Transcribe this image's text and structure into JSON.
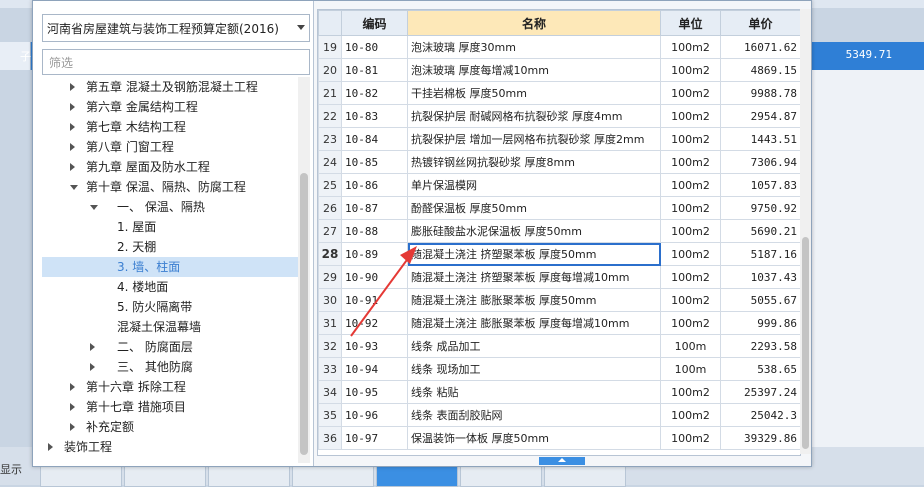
{
  "background": {
    "row_value": "5349.71",
    "row_left_char": "子",
    "bottom_label": "显示"
  },
  "dialog": {
    "library": "河南省房屋建筑与装饰工程预算定额(2016)",
    "filter_placeholder": "筛选",
    "tree": [
      {
        "label": "第五章 混凝土及钢筋混凝土工程",
        "level": 1,
        "toggle": "collapsed",
        "selected": false
      },
      {
        "label": "第六章 金属结构工程",
        "level": 1,
        "toggle": "collapsed",
        "selected": false
      },
      {
        "label": "第七章 木结构工程",
        "level": 1,
        "toggle": "collapsed",
        "selected": false
      },
      {
        "label": "第八章 门窗工程",
        "level": 1,
        "toggle": "collapsed",
        "selected": false
      },
      {
        "label": "第九章 屋面及防水工程",
        "level": 1,
        "toggle": "collapsed",
        "selected": false
      },
      {
        "label": "第十章 保温、隔热、防腐工程",
        "level": 1,
        "toggle": "expanded",
        "selected": false
      },
      {
        "label": "一、 保温、隔热",
        "level": 2,
        "toggle": "expanded",
        "selected": false
      },
      {
        "label": "1. 屋面",
        "level": 3,
        "toggle": "none",
        "selected": false
      },
      {
        "label": "2. 天棚",
        "level": 3,
        "toggle": "none",
        "selected": false
      },
      {
        "label": "3. 墙、柱面",
        "level": 3,
        "toggle": "none",
        "selected": true
      },
      {
        "label": "4. 楼地面",
        "level": 3,
        "toggle": "none",
        "selected": false
      },
      {
        "label": "5. 防火隔离带",
        "level": 3,
        "toggle": "none",
        "selected": false
      },
      {
        "label": "混凝土保温幕墙",
        "level": 3,
        "toggle": "none",
        "selected": false
      },
      {
        "label": "二、 防腐面层",
        "level": 2,
        "toggle": "collapsed",
        "selected": false
      },
      {
        "label": "三、 其他防腐",
        "level": 2,
        "toggle": "collapsed",
        "selected": false
      },
      {
        "label": "第十六章 拆除工程",
        "level": 1,
        "toggle": "collapsed",
        "selected": false
      },
      {
        "label": "第十七章 措施项目",
        "level": 1,
        "toggle": "collapsed",
        "selected": false
      },
      {
        "label": "补充定额",
        "level": 1,
        "toggle": "collapsed",
        "selected": false
      },
      {
        "label": "装饰工程",
        "level": 0,
        "toggle": "collapsed",
        "selected": false
      }
    ],
    "grid": {
      "headers": {
        "code": "编码",
        "name": "名称",
        "unit": "单位",
        "price": "单价"
      },
      "current_row": 28,
      "rows": [
        {
          "idx": "19",
          "code": "10-80",
          "name": "泡沫玻璃 厚度30mm",
          "unit": "100m2",
          "price": "16071.62"
        },
        {
          "idx": "20",
          "code": "10-81",
          "name": "泡沫玻璃 厚度每增减10mm",
          "unit": "100m2",
          "price": "4869.15"
        },
        {
          "idx": "21",
          "code": "10-82",
          "name": "干挂岩棉板 厚度50mm",
          "unit": "100m2",
          "price": "9988.78"
        },
        {
          "idx": "22",
          "code": "10-83",
          "name": "抗裂保护层 耐碱网格布抗裂砂浆 厚度4mm",
          "unit": "100m2",
          "price": "2954.87"
        },
        {
          "idx": "23",
          "code": "10-84",
          "name": "抗裂保护层 增加一层网格布抗裂砂浆 厚度2mm",
          "unit": "100m2",
          "price": "1443.51"
        },
        {
          "idx": "24",
          "code": "10-85",
          "name": "热镀锌钢丝网抗裂砂浆 厚度8mm",
          "unit": "100m2",
          "price": "7306.94"
        },
        {
          "idx": "25",
          "code": "10-86",
          "name": "单片保温模网",
          "unit": "100m2",
          "price": "1057.83"
        },
        {
          "idx": "26",
          "code": "10-87",
          "name": "酚醛保温板 厚度50mm",
          "unit": "100m2",
          "price": "9750.92"
        },
        {
          "idx": "27",
          "code": "10-88",
          "name": "膨胀硅酸盐水泥保温板 厚度50mm",
          "unit": "100m2",
          "price": "5690.21"
        },
        {
          "idx": "28",
          "code": "10-89",
          "name": "随混凝土浇注 挤塑聚苯板 厚度50mm",
          "unit": "100m2",
          "price": "5187.16"
        },
        {
          "idx": "29",
          "code": "10-90",
          "name": "随混凝土浇注 挤塑聚苯板 厚度每增减10mm",
          "unit": "100m2",
          "price": "1037.43"
        },
        {
          "idx": "30",
          "code": "10-91",
          "name": "随混凝土浇注 膨胀聚苯板 厚度50mm",
          "unit": "100m2",
          "price": "5055.67"
        },
        {
          "idx": "31",
          "code": "10-92",
          "name": "随混凝土浇注 膨胀聚苯板 厚度每增减10mm",
          "unit": "100m2",
          "price": "999.86"
        },
        {
          "idx": "32",
          "code": "10-93",
          "name": "线条 成品加工",
          "unit": "100m",
          "price": "2293.58"
        },
        {
          "idx": "33",
          "code": "10-94",
          "name": "线条 现场加工",
          "unit": "100m",
          "price": "538.65"
        },
        {
          "idx": "34",
          "code": "10-95",
          "name": "线条 粘贴",
          "unit": "100m2",
          "price": "25397.24"
        },
        {
          "idx": "35",
          "code": "10-96",
          "name": "线条 表面刮胶贴网",
          "unit": "100m2",
          "price": "25042.3"
        },
        {
          "idx": "36",
          "code": "10-97",
          "name": "保温装饰一体板 厚度50mm",
          "unit": "100m2",
          "price": "39329.86"
        }
      ]
    }
  },
  "colors": {
    "accent": "#3b8fe3",
    "selection": "#cfe3f7",
    "annotation": "#e53935",
    "header_highlight": "#fde8b8"
  }
}
